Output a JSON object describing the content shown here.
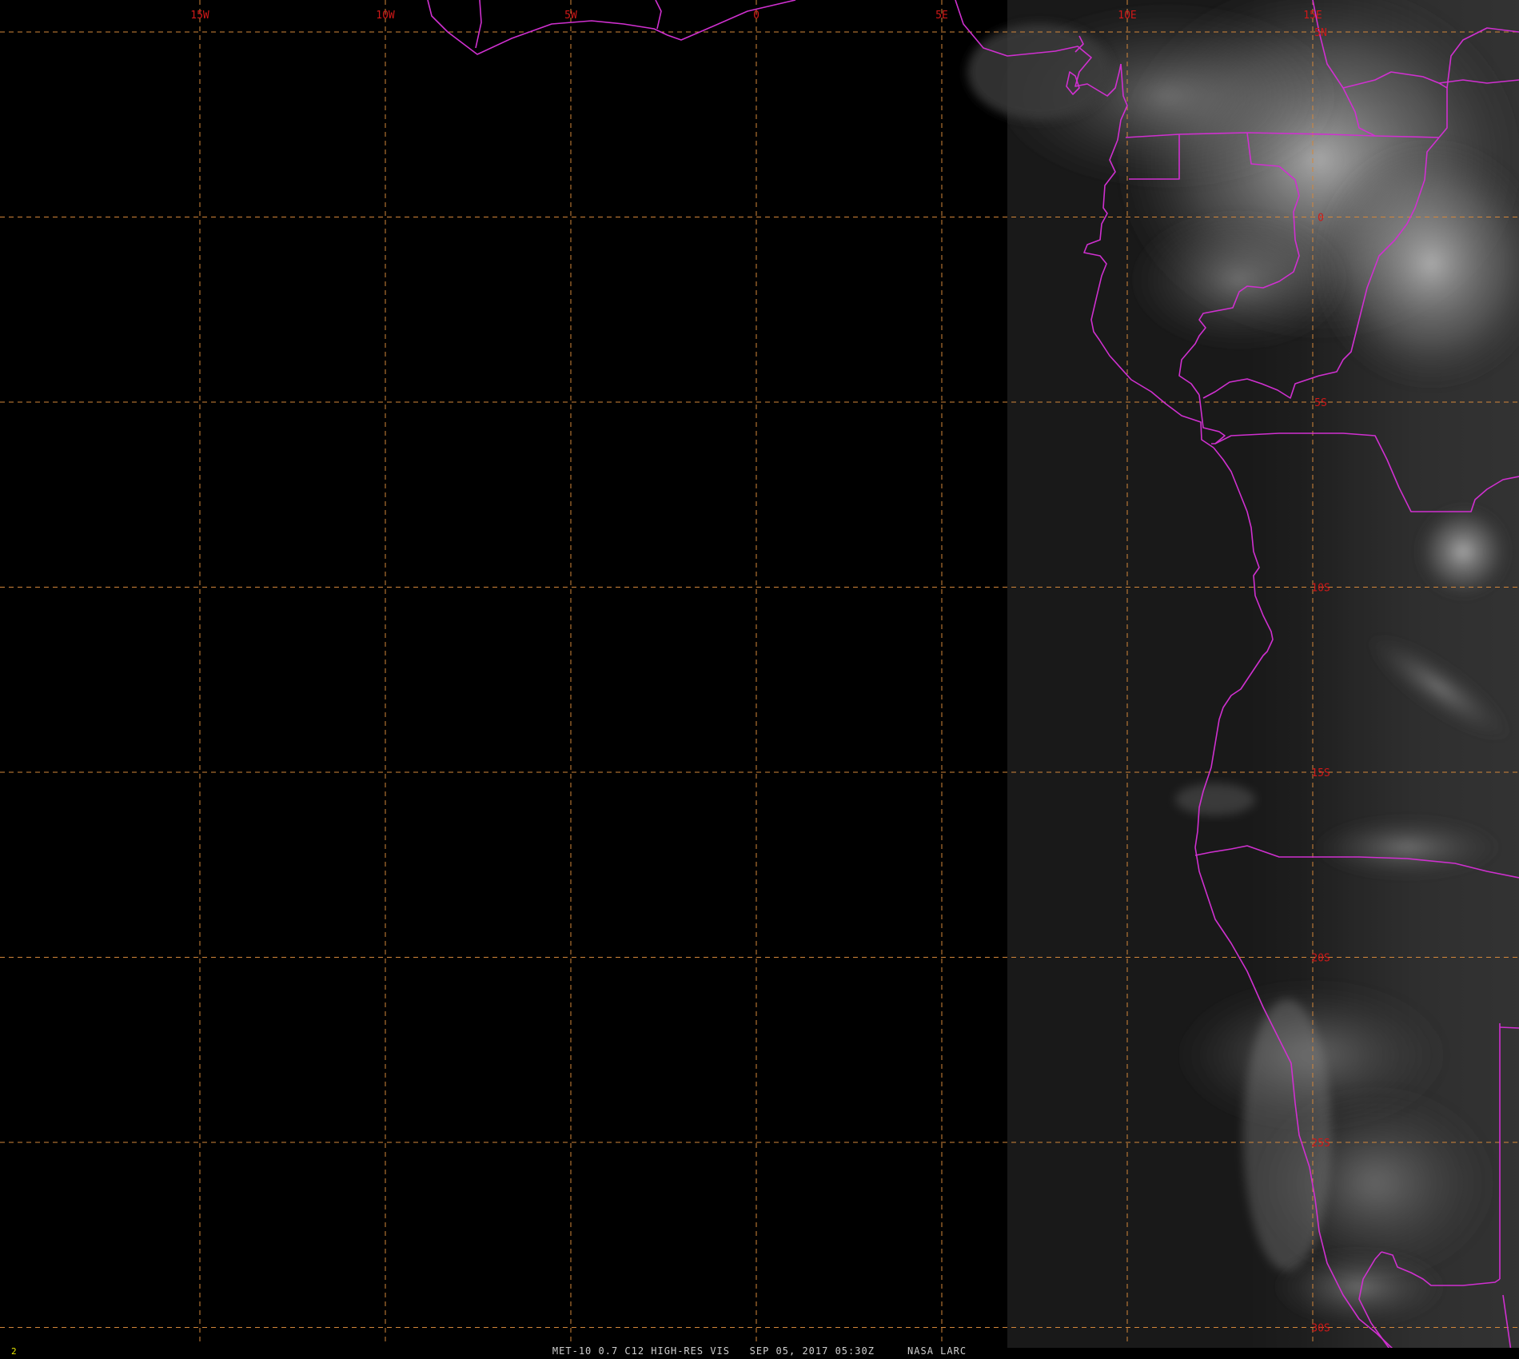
{
  "image": {
    "satellite": "MET-10",
    "channel_caption": "MET-10 0.7 C12 HIGH-RES VIS",
    "datetime": "SEP 05, 2017 05:30Z",
    "credit": "NASA LARC",
    "footer_line": "MET-10 0.7 C12 HIGH-RES VIS   SEP 05, 2017 05:30Z     NASA LARC",
    "frame_number": "2"
  },
  "graticule": {
    "longitude_labels": [
      "15W",
      "10W",
      "5W",
      "0",
      "5E",
      "10E",
      "15E"
    ],
    "latitude_labels": [
      "5N",
      "0",
      "5S",
      "10S",
      "15S",
      "20S",
      "25S",
      "30S"
    ],
    "longitudes": [
      -15,
      -10,
      -5,
      0,
      5,
      10,
      15
    ],
    "latitudes": [
      5,
      0,
      -5,
      -10,
      -15,
      -20,
      -25,
      -30
    ],
    "line_style": "dashed",
    "line_color": "#d4873a",
    "label_color": "#d01818"
  },
  "map": {
    "region": "West-central and southwestern Africa / South Atlantic Ocean",
    "lon_range": [
      -20,
      20.5
    ],
    "lat_range": [
      5.6,
      -30.4
    ],
    "boundary_color": "#d030d0",
    "terminator": "night side to the west, daylight over the African coast"
  }
}
